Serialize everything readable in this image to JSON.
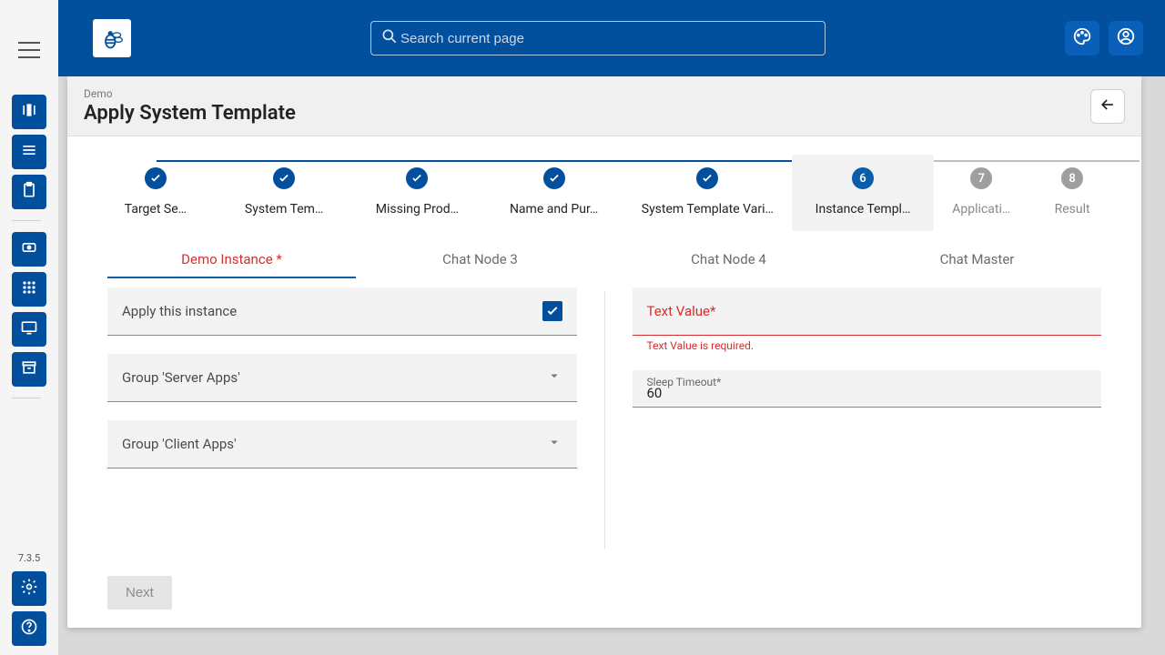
{
  "sidebar": {
    "version": "7.3.5",
    "groups": [
      {
        "icon": "deploy-icon"
      },
      {
        "icon": "list-icon"
      },
      {
        "icon": "clipboard-icon"
      }
    ],
    "groups2": [
      {
        "icon": "cloud-icon"
      },
      {
        "icon": "grid-icon"
      },
      {
        "icon": "monitor-icon"
      },
      {
        "icon": "archive-icon"
      }
    ],
    "bottom": [
      {
        "icon": "gear-icon"
      },
      {
        "icon": "help-icon"
      }
    ]
  },
  "header": {
    "search_placeholder": "Search current page"
  },
  "page": {
    "breadcrumb": "Demo",
    "title": "Apply System Template"
  },
  "stepper": [
    {
      "label": "Target Se…",
      "state": "done"
    },
    {
      "label": "System Tem…",
      "state": "done"
    },
    {
      "label": "Missing Prod…",
      "state": "done"
    },
    {
      "label": "Name and Pur…",
      "state": "done"
    },
    {
      "label": "System Template Vari…",
      "state": "done"
    },
    {
      "label": "Instance Templ…",
      "state": "current",
      "num": "6"
    },
    {
      "label": "Applicati…",
      "state": "future",
      "num": "7"
    },
    {
      "label": "Result",
      "state": "future",
      "num": "8"
    }
  ],
  "tabs": [
    {
      "label": "Demo Instance *",
      "active": true
    },
    {
      "label": "Chat Node 3",
      "active": false
    },
    {
      "label": "Chat Node 4",
      "active": false
    },
    {
      "label": "Chat Master",
      "active": false
    }
  ],
  "left_form": {
    "apply": {
      "label": "Apply this instance",
      "checked": true
    },
    "group1": {
      "label": "Group 'Server Apps'"
    },
    "group2": {
      "label": "Group 'Client Apps'"
    }
  },
  "right_form": {
    "text_value": {
      "label": "Text Value*",
      "error": "Text Value is required."
    },
    "sleep": {
      "label": "Sleep Timeout*",
      "value": "60"
    }
  },
  "footer": {
    "next": "Next"
  }
}
